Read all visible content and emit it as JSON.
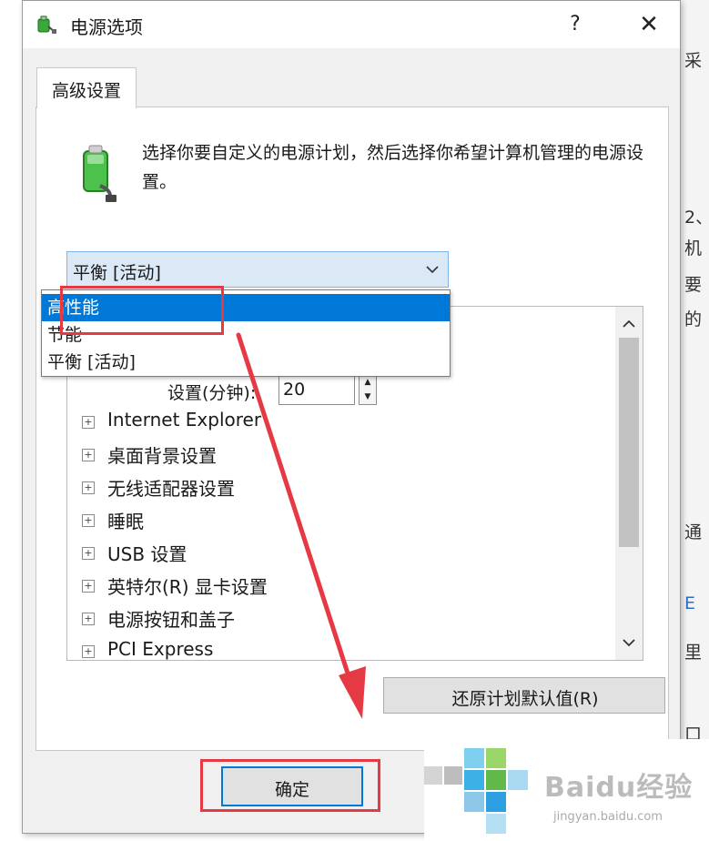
{
  "dialog": {
    "title": "电源选项",
    "help": "?",
    "close": "✕"
  },
  "tab": {
    "label": "高级设置"
  },
  "description": "选择你要自定义的电源计划，然后选择你希望计算机管理的电源设置。",
  "plan_select": {
    "value": "平衡 [活动]",
    "options": [
      "高性能",
      "节能",
      "平衡 [活动]"
    ],
    "highlighted_index": 0
  },
  "settings": {
    "sleep_label": "设置(分钟):",
    "sleep_value": "20",
    "items": [
      "Internet Explorer",
      "桌面背景设置",
      "无线适配器设置",
      "睡眠",
      "USB 设置",
      "英特尔(R) 显卡设置",
      "电源按钮和盖子",
      "PCI Express"
    ],
    "expand_glyph": "+"
  },
  "buttons": {
    "restore": "还原计划默认值(R)",
    "ok": "确定"
  },
  "background_fragments": [
    "采",
    "2、",
    "机",
    "要",
    "的",
    "通",
    "E",
    "里",
    "口"
  ],
  "watermark": {
    "logo": "Baidu经验",
    "site": "jingyan.baidu.com"
  },
  "colors": {
    "accent": "#0078d7",
    "annotation": "#e53a44",
    "select_bg": "#dbe9f7"
  }
}
